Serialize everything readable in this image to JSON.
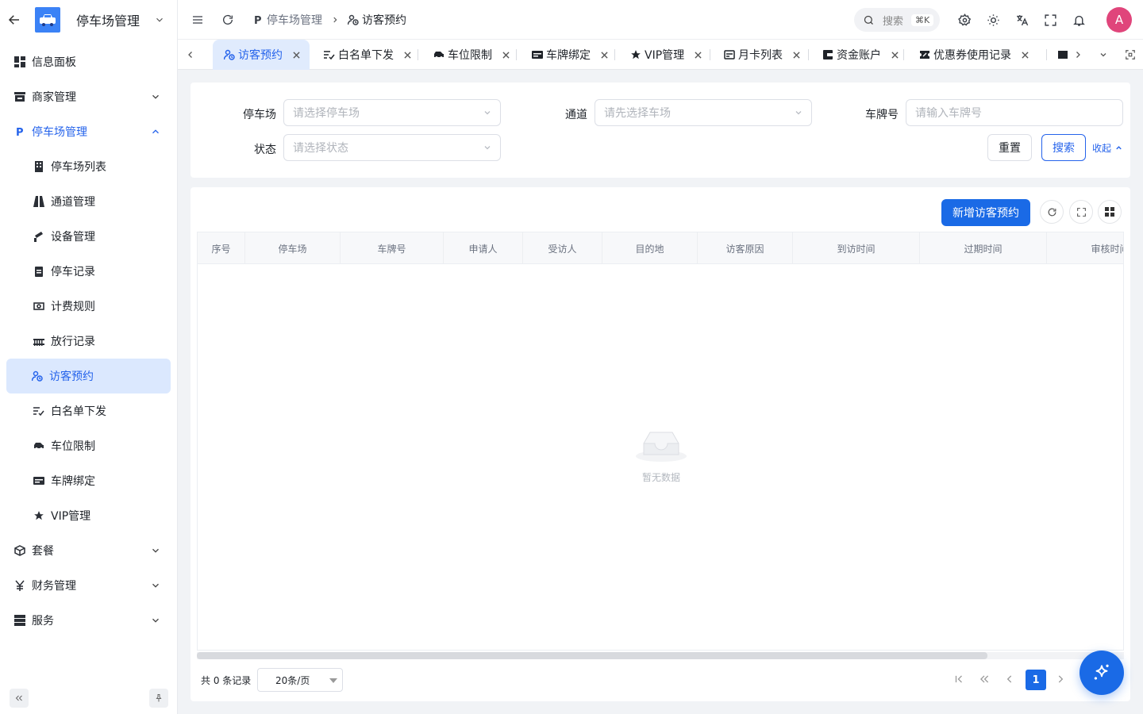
{
  "sidebar": {
    "title": "停车场管理",
    "items": [
      {
        "label": "信息面板",
        "icon": "dashboard-icon"
      },
      {
        "label": "商家管理",
        "icon": "store-icon"
      },
      {
        "label": "停车场管理",
        "icon": "parking-icon"
      },
      {
        "label": "停车场列表",
        "icon": "building-icon"
      },
      {
        "label": "通道管理",
        "icon": "road-icon"
      },
      {
        "label": "设备管理",
        "icon": "device-icon"
      },
      {
        "label": "停车记录",
        "icon": "clipboard-icon"
      },
      {
        "label": "计费规则",
        "icon": "money-icon"
      },
      {
        "label": "放行记录",
        "icon": "gate-icon"
      },
      {
        "label": "访客预约",
        "icon": "visitor-icon"
      },
      {
        "label": "白名单下发",
        "icon": "list-check-icon"
      },
      {
        "label": "车位限制",
        "icon": "car-icon"
      },
      {
        "label": "车牌绑定",
        "icon": "card-icon"
      },
      {
        "label": "VIP管理",
        "icon": "star-icon"
      },
      {
        "label": "套餐",
        "icon": "package-icon"
      },
      {
        "label": "财务管理",
        "icon": "yen-icon"
      },
      {
        "label": "服务",
        "icon": "server-icon"
      }
    ]
  },
  "header": {
    "breadcrumb": [
      "停车场管理",
      "访客预约"
    ],
    "search_label": "搜索",
    "search_kbd": "⌘K",
    "avatar_letter": "A"
  },
  "tabs": [
    {
      "label": "访客预约",
      "active": true
    },
    {
      "label": "白名单下发"
    },
    {
      "label": "车位限制"
    },
    {
      "label": "车牌绑定"
    },
    {
      "label": "VIP管理"
    },
    {
      "label": "月卡列表"
    },
    {
      "label": "资金账户"
    },
    {
      "label": "优惠券使用记录"
    }
  ],
  "filters": {
    "parking_label": "停车场",
    "parking_placeholder": "请选择停车场",
    "channel_label": "通道",
    "channel_placeholder": "请先选择车场",
    "plate_label": "车牌号",
    "plate_placeholder": "请输入车牌号",
    "status_label": "状态",
    "status_placeholder": "请选择状态",
    "reset": "重置",
    "search": "搜索",
    "collapse": "收起"
  },
  "toolbar": {
    "add_label": "新增访客预约"
  },
  "table": {
    "columns": [
      "序号",
      "停车场",
      "车牌号",
      "申请人",
      "受访人",
      "目的地",
      "访客原因",
      "到访时间",
      "过期时间",
      "审核时间"
    ],
    "rows": [],
    "empty_text": "暂无数据"
  },
  "pagination": {
    "total_text": "共 0 条记录",
    "page_size": "20条/页",
    "current_page": "1"
  },
  "colors": {
    "primary": "#1a6ae6",
    "active_bg": "#dbe8fe",
    "avatar": "#e0457b"
  }
}
